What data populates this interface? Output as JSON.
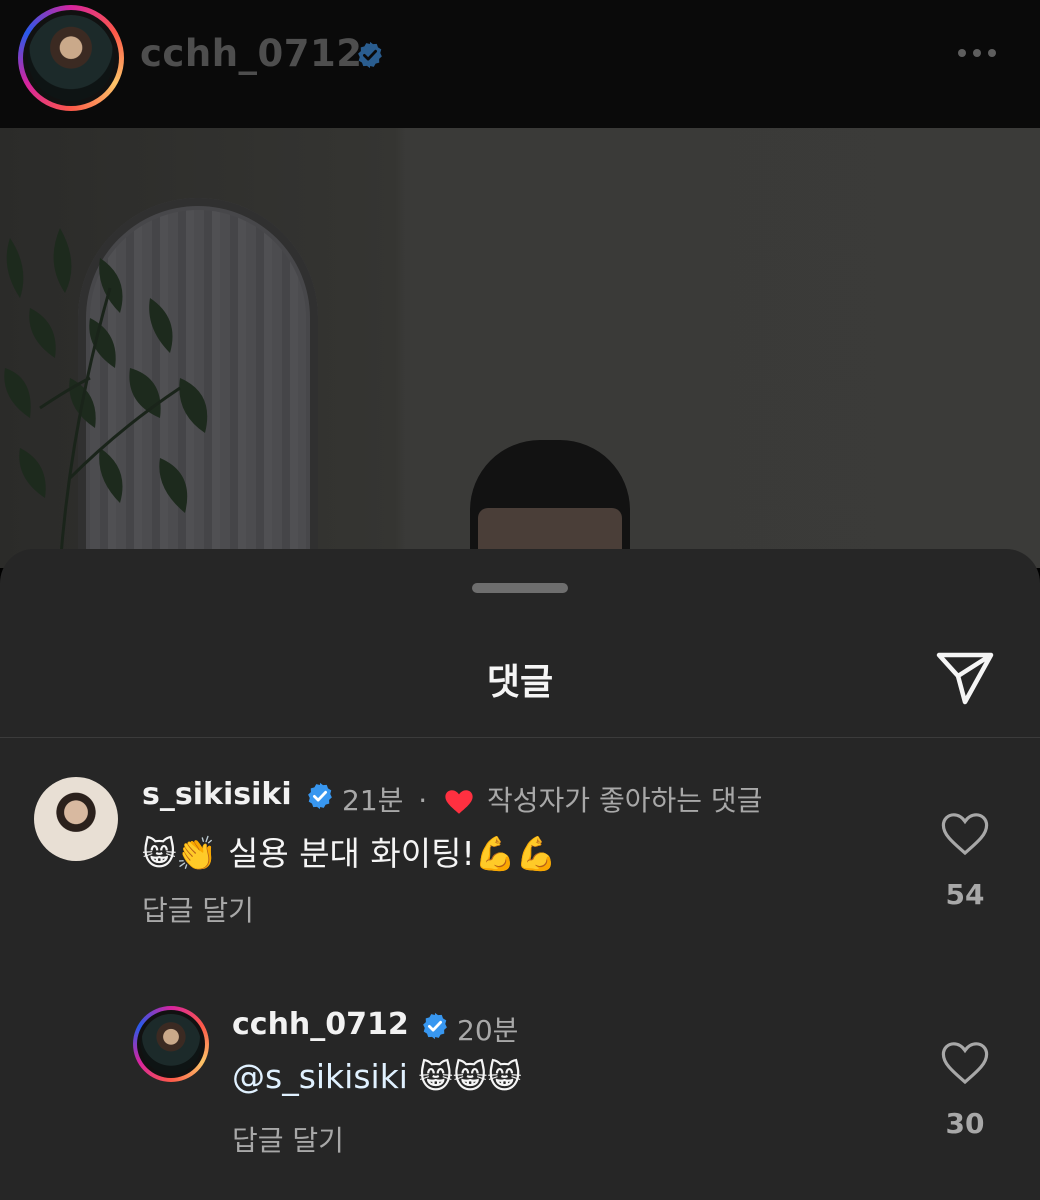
{
  "post": {
    "username": "cchh_0712"
  },
  "comments_sheet": {
    "title": "댓글",
    "comments": [
      {
        "username": "s_sikisiki",
        "time": "21분",
        "separator": "·",
        "liked_by_author_label": "작성자가 좋아하는 댓글",
        "text": "😸👏 실용 분대 화이팅!💪💪",
        "reply_label": "답글 달기",
        "like_count": "54"
      },
      {
        "username": "cchh_0712",
        "time": "20분",
        "mention": "@s_sikisiki",
        "text": " 😸😸😸",
        "reply_label": "답글 달기",
        "like_count": "30"
      }
    ]
  },
  "colors": {
    "sheet_background": "#262626",
    "verified_blue": "#3897f0",
    "author_like_red": "#ff3040"
  }
}
